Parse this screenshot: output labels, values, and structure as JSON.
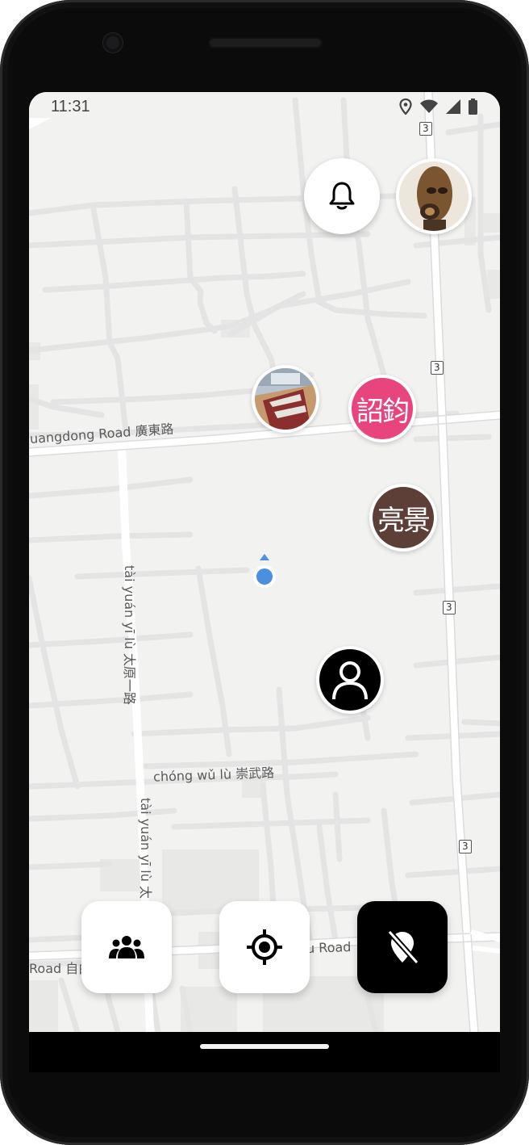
{
  "status": {
    "time": "11:31",
    "icons": [
      "location-icon",
      "wifi-icon",
      "signal-icon",
      "battery-icon"
    ]
  },
  "map": {
    "background": "#f2f2f1",
    "road_labels": {
      "guangdong": "uangdong Road 廣東路",
      "taiyuan1": "tài yuán yī lù 太原一路",
      "chongwu": "chóng wǔ lù 崇武路",
      "taiyuan2": "tài yuán yī lù 太",
      "road_bottom_left": "Road 自由",
      "road_bottom_mid": "u Road"
    },
    "route_shields": [
      "3",
      "3",
      "3",
      "3"
    ]
  },
  "top_controls": {
    "notification_icon": "bell-icon",
    "profile_icon": "profile-photo"
  },
  "markers": {
    "user1_kanji": "詔鈞",
    "user1_color": "#e8457e",
    "user2_kanji": "亮景",
    "user2_color": "#5d3f38",
    "user3_icon": "person-icon"
  },
  "bottom_bar": {
    "friends_icon": "group-icon",
    "locate_icon": "crosshair-icon",
    "hide_location_icon": "location-off-icon"
  }
}
